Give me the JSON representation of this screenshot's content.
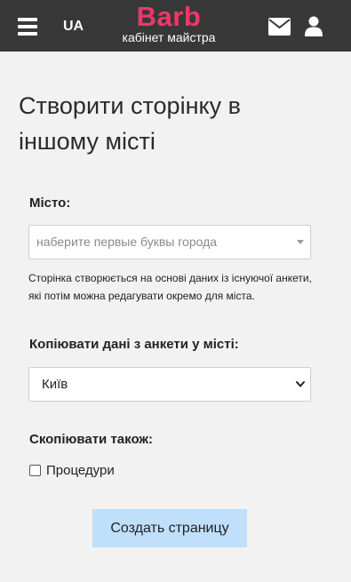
{
  "header": {
    "language": "UA",
    "logo_title": "Barb",
    "logo_subtitle": "кабінет майстра",
    "icons": [
      "menu-icon",
      "mail-icon",
      "user-icon"
    ]
  },
  "page": {
    "title": "Створити сторінку в іншому місті"
  },
  "form": {
    "city_label": "Місто:",
    "city_placeholder": "наберите первые буквы города",
    "hint": "Сторінка створюється на основі даних із існуючої анкети, які потім можна редагувати окремо для міста.",
    "copy_label": "Копіювати дані з анкети у місті:",
    "copy_selected": "Київ",
    "also_label": "Скопіювати також:",
    "procedures_label": "Процедури",
    "procedures_checked": false,
    "submit_label": "Создать страницу"
  },
  "colors": {
    "topbar": "#383838",
    "brand": "#f0366a",
    "button": "#bfdffb",
    "background": "#f2f2f2"
  }
}
